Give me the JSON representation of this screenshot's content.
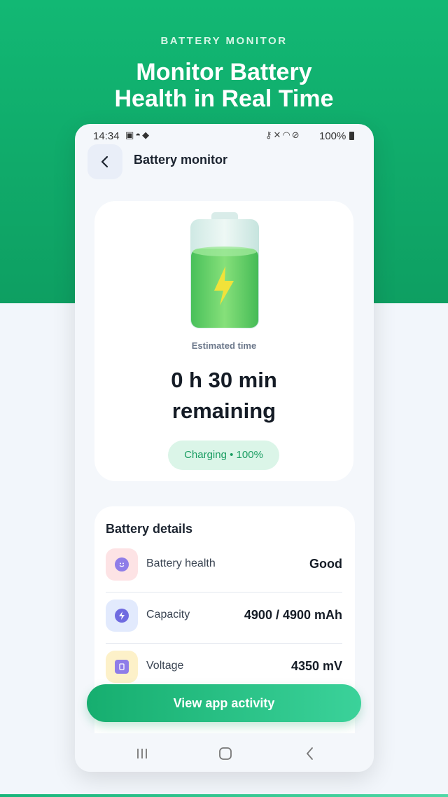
{
  "promo": {
    "kicker": "BATTERY MONITOR",
    "title_line1": "Monitor Battery",
    "title_line2": "Health in Real Time"
  },
  "status_bar": {
    "time": "14:34",
    "battery_percent": "100%",
    "left_icons": [
      "gallery-icon",
      "steam-icon",
      "cat-icon"
    ],
    "right_icons": [
      "key-icon",
      "mute-icon",
      "wifi-icon",
      "do-not-disturb-icon",
      "battery-icon"
    ]
  },
  "app_bar": {
    "back_icon": "chevron-left-icon",
    "title": "Battery monitor"
  },
  "main_card": {
    "estimated_label": "Estimated time",
    "estimated_line1": "0 h 30 min",
    "estimated_line2": "remaining",
    "charging_status": "Charging • 100%",
    "charge_level": 1.0
  },
  "details": {
    "title": "Battery details",
    "rows": [
      {
        "label": "Battery health",
        "value": "Good",
        "icon": "smiley-icon",
        "icon_bg": "#fde3e5",
        "icon_color": "#8f7de8"
      },
      {
        "label": "Capacity",
        "value": "4900 / 4900 mAh",
        "icon": "bolt-icon",
        "icon_bg": "#e2eafd",
        "icon_color": "#6f6be0"
      },
      {
        "label": "Voltage",
        "value": "4350 mV",
        "icon": "battery-box-icon",
        "icon_bg": "#fdf1c9",
        "icon_color": "#8f7de8"
      }
    ]
  },
  "cta": {
    "label": "View app activity"
  },
  "nav_bar": {
    "items": [
      "recents-icon",
      "home-icon",
      "back-icon"
    ]
  },
  "colors": {
    "brand_green": "#12b874",
    "charging_text": "#1a9d62",
    "charging_bg": "#dbf5e8"
  }
}
